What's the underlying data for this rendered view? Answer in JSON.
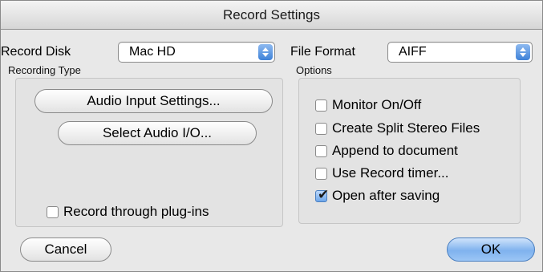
{
  "window": {
    "title": "Record Settings"
  },
  "record_disk": {
    "label": "Record Disk",
    "value": "Mac HD"
  },
  "file_format": {
    "label": "File Format",
    "value": "AIFF"
  },
  "recording_type": {
    "heading": "Recording Type",
    "audio_input_settings": "Audio Input Settings...",
    "select_audio_io": "Select Audio I/O...",
    "record_through_plugins": {
      "label": "Record through plug-ins",
      "checked": false
    }
  },
  "options": {
    "heading": "Options",
    "items": [
      {
        "label": "Monitor On/Off",
        "checked": false
      },
      {
        "label": "Create Split Stereo Files",
        "checked": false
      },
      {
        "label": "Append to document",
        "checked": false
      },
      {
        "label": "Use Record timer...",
        "checked": false
      },
      {
        "label": "Open after saving",
        "checked": true
      }
    ]
  },
  "buttons": {
    "cancel": "Cancel",
    "ok": "OK"
  },
  "colors": {
    "accent": "#6da6ea",
    "background": "#e8e8e8"
  }
}
